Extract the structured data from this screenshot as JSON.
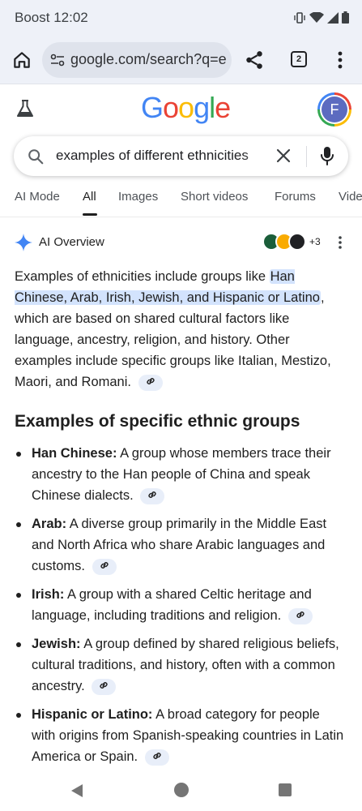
{
  "status_bar": {
    "carrier_time": "Boost 12:02"
  },
  "browser": {
    "url": "google.com/search?q=e",
    "tab_count": "2"
  },
  "google": {
    "logo_letters": [
      "G",
      "o",
      "o",
      "g",
      "l",
      "e"
    ],
    "logo_colors": [
      "#4285f4",
      "#ea4335",
      "#fbbc05",
      "#4285f4",
      "#34a853",
      "#ea4335"
    ],
    "avatar_initial": "F"
  },
  "search": {
    "query": "examples of different ethnicities"
  },
  "tabs": [
    "AI Mode",
    "All",
    "Images",
    "Short videos",
    "Forums",
    "Vide"
  ],
  "active_tab": "All",
  "ai_overview": {
    "title": "AI Overview",
    "source_count": "+3",
    "intro_start": "Examples of ethnicities include groups like ",
    "intro_highlight": "Han Chinese, Arab, Irish, Jewish, and Hispanic or Latino",
    "intro_end": ", which are based on shared cultural factors like language, ancestry, religion, and history. Other examples include specific groups like Italian, Mestizo, Maori, and Romani."
  },
  "section": {
    "title": "Examples of specific ethnic groups",
    "items": [
      {
        "name": "Han Chinese:",
        "text": " A group whose members trace their ancestry to the Han people of China and speak Chinese dialects."
      },
      {
        "name": "Arab:",
        "text": " A diverse group primarily in the Middle East and North Africa who share Arabic languages and customs."
      },
      {
        "name": "Irish:",
        "text": " A group with a shared Celtic heritage and language, including traditions and religion."
      },
      {
        "name": "Jewish:",
        "text": " A group defined by shared religious beliefs, cultural traditions, and history, often with a common ancestry."
      },
      {
        "name": "Hispanic or Latino:",
        "text": " A broad category for people with origins from Spanish-speaking countries in Latin America or Spain."
      }
    ]
  },
  "colors": {
    "highlight": "#d3e3fd",
    "link_chip": "#e8eef9",
    "browser_bg": "#eef1f8"
  }
}
